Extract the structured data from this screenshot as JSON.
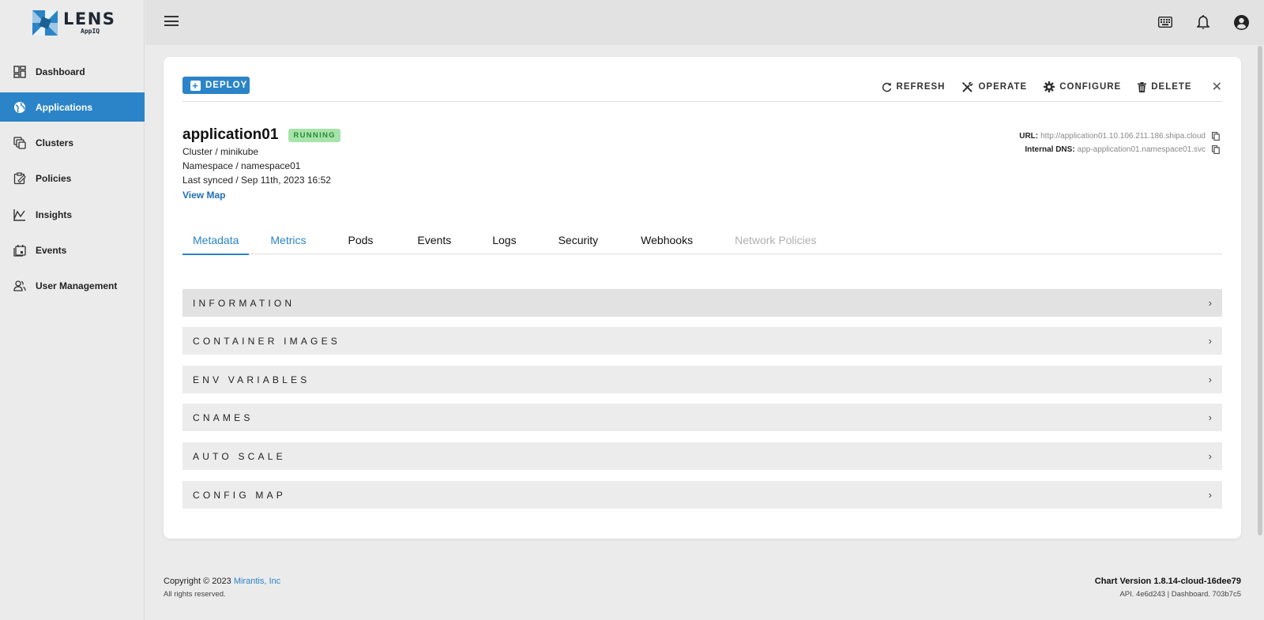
{
  "logo": {
    "title": "LENS",
    "subtitle": "AppIQ",
    "icon": "lens-aperture-logo"
  },
  "sidebar": {
    "items": [
      {
        "label": "Dashboard",
        "icon": "dashboard-icon",
        "active": false
      },
      {
        "label": "Applications",
        "icon": "globe-icon",
        "active": true
      },
      {
        "label": "Clusters",
        "icon": "clusters-icon",
        "active": false
      },
      {
        "label": "Policies",
        "icon": "policies-icon",
        "active": false
      },
      {
        "label": "Insights",
        "icon": "insights-chart-icon",
        "active": false
      },
      {
        "label": "Events",
        "icon": "events-icon",
        "active": false
      },
      {
        "label": "User Management",
        "icon": "users-icon",
        "active": false
      }
    ]
  },
  "topbar": {
    "icons": [
      "keyboard-icon",
      "bell-icon",
      "account-icon"
    ]
  },
  "toolbar": {
    "deploy_label": "DEPLOY",
    "refresh_label": "REFRESH",
    "operate_label": "OPERATE",
    "configure_label": "CONFIGURE",
    "delete_label": "DELETE"
  },
  "app": {
    "name": "application01",
    "status": "RUNNING",
    "cluster": "Cluster / minikube",
    "namespace": "Namespace / namespace01",
    "last_synced": "Last synced / Sep 11th, 2023 16:52",
    "view_map": "View Map",
    "url_label": "URL:",
    "url_value": "http://application01.10.106.211.186.shipa.cloud",
    "dns_label": "Internal DNS:",
    "dns_value": "app-application01.namespace01.svc"
  },
  "tabs": [
    {
      "label": "Metadata",
      "state": "active"
    },
    {
      "label": "Metrics",
      "state": "link"
    },
    {
      "label": "Pods",
      "state": "normal"
    },
    {
      "label": "Events",
      "state": "normal"
    },
    {
      "label": "Logs",
      "state": "normal"
    },
    {
      "label": "Security",
      "state": "normal"
    },
    {
      "label": "Webhooks",
      "state": "normal"
    },
    {
      "label": "Network Policies",
      "state": "disabled"
    }
  ],
  "sections": [
    {
      "label": "INFORMATION"
    },
    {
      "label": "CONTAINER IMAGES"
    },
    {
      "label": "ENV VARIABLES"
    },
    {
      "label": "CNAMES"
    },
    {
      "label": "AUTO SCALE"
    },
    {
      "label": "CONFIG MAP"
    }
  ],
  "footer": {
    "copyright": "Copyright © 2023 ",
    "company": "Mirantis, Inc",
    "rights": "All rights reserved.",
    "chart_version": "Chart Version 1.8.14-cloud-16dee79",
    "build": "API. 4e6d243 | Dashboard. 703b7c5"
  },
  "colors": {
    "accent": "#2b84c7",
    "running_bg": "#a7e4ab",
    "running_text": "#2a8a34"
  }
}
